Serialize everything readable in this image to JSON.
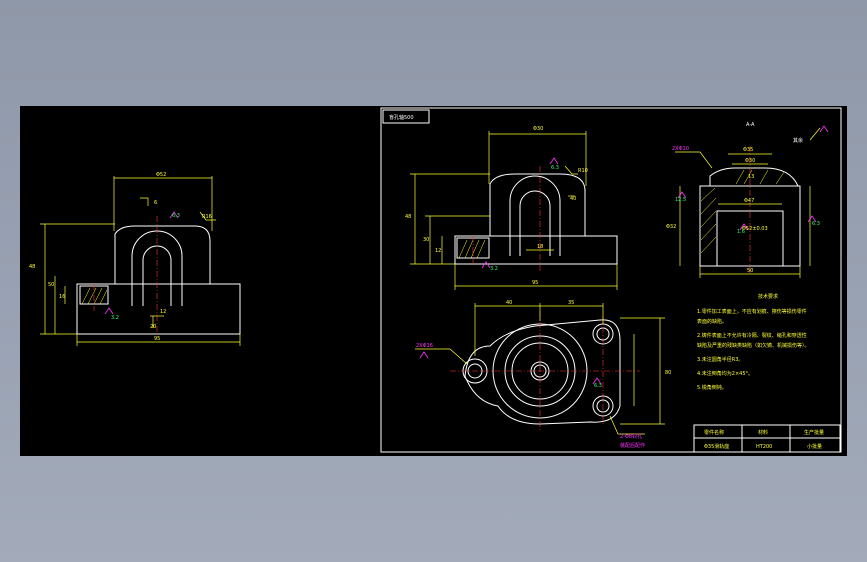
{
  "frame": {
    "tag_label": "盲孔轴500"
  },
  "left_view": {
    "dim_top": "Φ52",
    "dim_right": "R16",
    "roughness_top": "6.3",
    "dim_height_total": "48",
    "dim_height_base": "50",
    "dim_small": "16",
    "dim_hole": "12",
    "dim_bottom": "95",
    "roughness_bottom": "3.2",
    "dim_gap": "6",
    "dim_inner": "20"
  },
  "front_view": {
    "dim_top": "Φ30",
    "dim_r": "R10",
    "roughness_1": "6.3",
    "roughness_2": "3.2",
    "dim_left_total": "48",
    "dim_left_mid": "30",
    "dim_left_small": "12",
    "dim_bottom": "95",
    "dim_inner": "18",
    "dim_slot": "40"
  },
  "section_view": {
    "title": "A-A",
    "label_thread": "2XΦ10",
    "label_finish": "其余",
    "dim_1": "Φ35",
    "dim_2": "Φ30",
    "dim_3": "Φ47",
    "dim_4": "Φ52±0.03",
    "dim_5": "50",
    "dim_6": "13",
    "dim_left": "Φ32",
    "roughness_left": "12.5",
    "roughness_right": "6.3",
    "roughness_inner": "1.6"
  },
  "top_view": {
    "dim_left": "40",
    "dim_right": "35",
    "dim_height": "80",
    "label_hole": "2XΦ16",
    "roughness": "6.3",
    "note_1": "2-Φ8铰孔",
    "note_2": "装配后配作"
  },
  "tech_notes": {
    "title": "技术要求",
    "lines": [
      "1.零件加工表面上，不应有划痕、擦伤等损伤零件",
      "  表面的缺陷。",
      "2.铸件表面上不允许有冷隔、裂纹、缩孔和穿透性",
      "  缺陷及严重的残缺类缺陷（如欠铸、机械损伤等）。",
      "3.未注圆角半径R3。",
      "4.未注倒角均为2×45°。",
      "5.锐角倒钝。"
    ]
  },
  "title_block": {
    "row1": [
      "零件名称",
      "材料",
      "生产批量"
    ],
    "row2": [
      "Φ35滑轨座",
      "HT200",
      "小批量"
    ]
  }
}
